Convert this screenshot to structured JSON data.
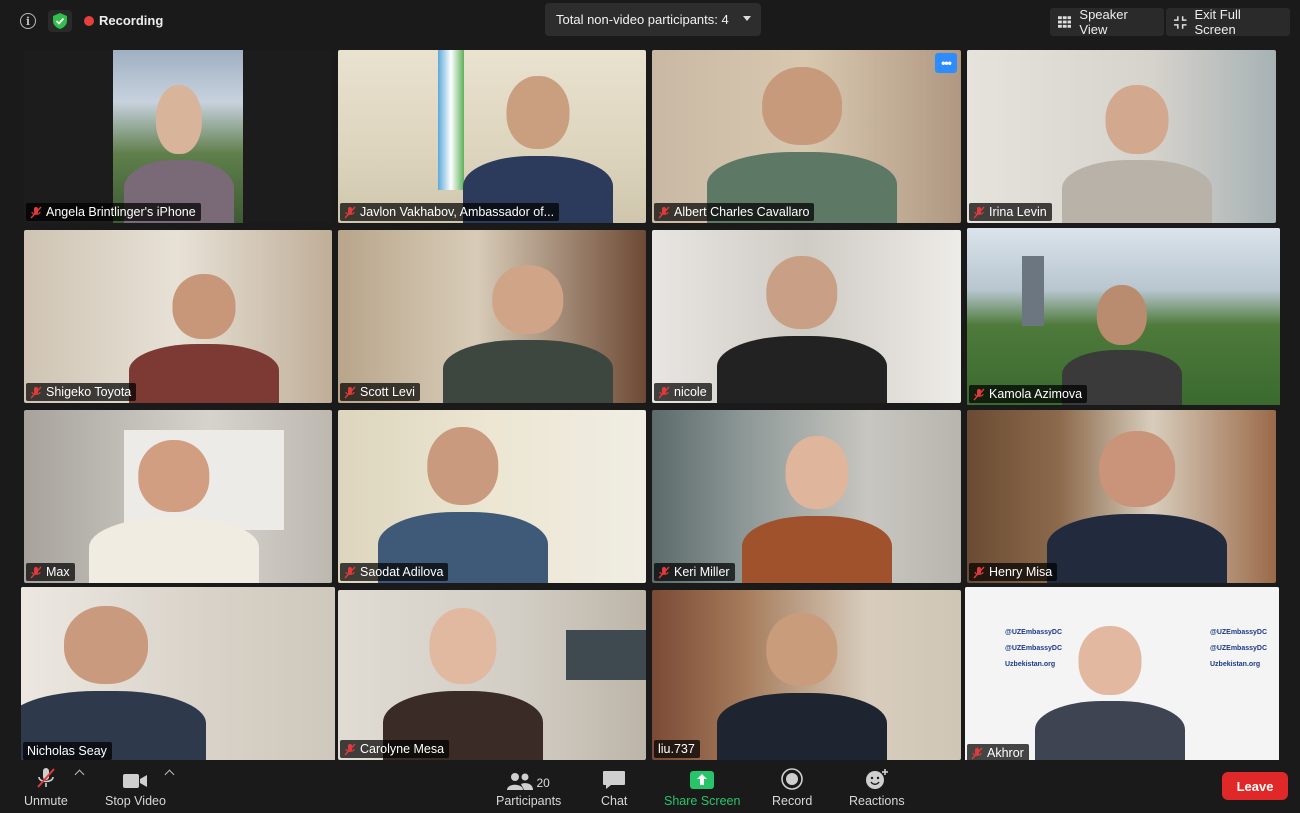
{
  "topbar": {
    "recording_label": "Recording",
    "participants_dropdown": "Total non-video participants: 4",
    "speaker_view_label": "Speaker View",
    "exit_fullscreen_label": "Exit Full Screen"
  },
  "tiles": [
    {
      "name": "Angela Brintlinger's iPhone",
      "muted": true
    },
    {
      "name": "Javlon Vakhabov, Ambassador of...",
      "muted": true
    },
    {
      "name": "Albert Charles Cavallaro",
      "muted": true
    },
    {
      "name": "Irina Levin",
      "muted": true
    },
    {
      "name": "Shigeko Toyota",
      "muted": true
    },
    {
      "name": "Scott Levi",
      "muted": true
    },
    {
      "name": "nicole",
      "muted": true
    },
    {
      "name": "Kamola Azimova",
      "muted": true
    },
    {
      "name": "Max",
      "muted": true
    },
    {
      "name": "Saodat Adilova",
      "muted": true
    },
    {
      "name": "Keri Miller",
      "muted": true
    },
    {
      "name": "Henry Misa",
      "muted": true
    },
    {
      "name": "Nicholas Seay",
      "muted": false,
      "active_speaker": true
    },
    {
      "name": "Carolyne Mesa",
      "muted": true
    },
    {
      "name": "liu.737",
      "muted": false
    },
    {
      "name": "Akhror",
      "muted": true
    }
  ],
  "tile_menu_glyph": "•••",
  "background_text": {
    "handle": "@UZEmbassyDC",
    "site": "Uzbekistan.org"
  },
  "bottombar": {
    "unmute_label": "Unmute",
    "stop_video_label": "Stop Video",
    "participants_label": "Participants",
    "participants_count": "20",
    "chat_label": "Chat",
    "share_screen_label": "Share Screen",
    "record_label": "Record",
    "reactions_label": "Reactions",
    "leave_label": "Leave"
  },
  "colors": {
    "active_speaker_border": "#c7d869",
    "share_screen_green": "#27c46a",
    "leave_red": "#e02828",
    "recording_red": "#e6403a",
    "menu_blue": "#2d8cff"
  }
}
